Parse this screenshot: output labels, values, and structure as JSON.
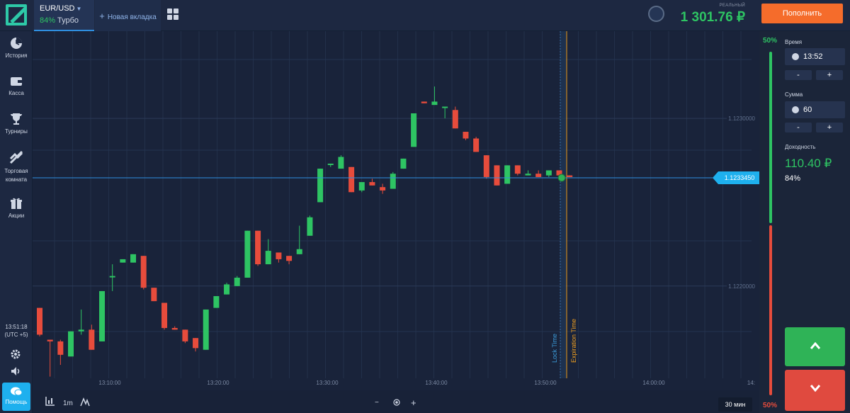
{
  "header": {
    "asset_pair": "EUR/USD",
    "asset_payout": "84%",
    "asset_mode": "Турбо",
    "new_tab_label": "Новая вкладка",
    "account_type": "РЕАЛЬНЫЙ",
    "balance": "1 301.76 ₽",
    "deposit_label": "Пополнить"
  },
  "sidebar": {
    "items": [
      {
        "label": "История",
        "icon": "history-icon"
      },
      {
        "label": "Касса",
        "icon": "wallet-icon"
      },
      {
        "label": "Турниры",
        "icon": "trophy-icon"
      },
      {
        "label": "Торговая комната",
        "icon": "trading-room-icon"
      },
      {
        "label": "Акции",
        "icon": "gift-icon"
      }
    ],
    "time": "13:51:18",
    "timezone": "(UTC +5)",
    "help_label": "Помощь"
  },
  "chart_data": {
    "type": "candlestick",
    "timeframe": "1m",
    "y_range": [
      1.12145,
      1.12352
    ],
    "y_ticks": [
      1.123,
      1.122
    ],
    "y_tick_labels": [
      "1.1230000",
      "1.1220000"
    ],
    "x_tick_labels": [
      "13:10:00",
      "13:20:00",
      "13:30:00",
      "13:40:00",
      "13:50:00",
      "14:00:00"
    ],
    "current_price": "1.1233450",
    "lock_time_label": "Lock Time",
    "expiration_time_label": "Expiration Time",
    "candles": [
      {
        "o": 1.12187,
        "h": 1.12187,
        "l": 1.1217,
        "c": 1.12171
      },
      {
        "o": 1.12168,
        "h": 1.12168,
        "l": 1.12146,
        "c": 1.12167
      },
      {
        "o": 1.12167,
        "h": 1.12168,
        "l": 1.12153,
        "c": 1.12159
      },
      {
        "o": 1.12158,
        "h": 1.12173,
        "l": 1.12158,
        "c": 1.12173
      },
      {
        "o": 1.12173,
        "h": 1.12186,
        "l": 1.12171,
        "c": 1.12174
      },
      {
        "o": 1.12174,
        "h": 1.12177,
        "l": 1.12162,
        "c": 1.12162
      },
      {
        "o": 1.12167,
        "h": 1.12197,
        "l": 1.12167,
        "c": 1.12197
      },
      {
        "o": 1.12206,
        "h": 1.12213,
        "l": 1.12197,
        "c": 1.12206
      },
      {
        "o": 1.12214,
        "h": 1.12216,
        "l": 1.12214,
        "c": 1.12216
      },
      {
        "o": 1.12214,
        "h": 1.12219,
        "l": 1.12214,
        "c": 1.12219
      },
      {
        "o": 1.12218,
        "h": 1.12218,
        "l": 1.12198,
        "c": 1.12199
      },
      {
        "o": 1.12199,
        "h": 1.12199,
        "l": 1.12191,
        "c": 1.12191
      },
      {
        "o": 1.1219,
        "h": 1.1219,
        "l": 1.12174,
        "c": 1.12175
      },
      {
        "o": 1.12175,
        "h": 1.12176,
        "l": 1.12174,
        "c": 1.12174
      },
      {
        "o": 1.12174,
        "h": 1.12174,
        "l": 1.12166,
        "c": 1.12167
      },
      {
        "o": 1.12169,
        "h": 1.12169,
        "l": 1.12161,
        "c": 1.12163
      },
      {
        "o": 1.12162,
        "h": 1.12186,
        "l": 1.12162,
        "c": 1.12186
      },
      {
        "o": 1.12187,
        "h": 1.12194,
        "l": 1.12187,
        "c": 1.12194
      },
      {
        "o": 1.12195,
        "h": 1.12202,
        "l": 1.12195,
        "c": 1.12201
      },
      {
        "o": 1.122,
        "h": 1.12206,
        "l": 1.122,
        "c": 1.12205
      },
      {
        "o": 1.12205,
        "h": 1.12233,
        "l": 1.12205,
        "c": 1.12233
      },
      {
        "o": 1.12233,
        "h": 1.12233,
        "l": 1.12212,
        "c": 1.12213
      },
      {
        "o": 1.12213,
        "h": 1.12228,
        "l": 1.12213,
        "c": 1.12221
      },
      {
        "o": 1.1222,
        "h": 1.1222,
        "l": 1.12214,
        "c": 1.12216
      },
      {
        "o": 1.12218,
        "h": 1.12218,
        "l": 1.12213,
        "c": 1.12215
      },
      {
        "o": 1.12219,
        "h": 1.12236,
        "l": 1.12219,
        "c": 1.12222
      },
      {
        "o": 1.1223,
        "h": 1.12242,
        "l": 1.1223,
        "c": 1.12241
      },
      {
        "o": 1.1225,
        "h": 1.1227,
        "l": 1.1225,
        "c": 1.1227
      },
      {
        "o": 1.12273,
        "h": 1.12273,
        "l": 1.12271,
        "c": 1.12273
      },
      {
        "o": 1.1227,
        "h": 1.12278,
        "l": 1.1227,
        "c": 1.12277
      },
      {
        "o": 1.12271,
        "h": 1.12271,
        "l": 1.12256,
        "c": 1.12256
      },
      {
        "o": 1.12257,
        "h": 1.1226,
        "l": 1.12256,
        "c": 1.12262
      },
      {
        "o": 1.12262,
        "h": 1.12264,
        "l": 1.1226,
        "c": 1.1226
      },
      {
        "o": 1.12259,
        "h": 1.12261,
        "l": 1.12255,
        "c": 1.12257
      },
      {
        "o": 1.12258,
        "h": 1.12268,
        "l": 1.12258,
        "c": 1.12267
      },
      {
        "o": 1.1227,
        "h": 1.12276,
        "l": 1.1227,
        "c": 1.12276
      },
      {
        "o": 1.12283,
        "h": 1.12303,
        "l": 1.12283,
        "c": 1.12303
      },
      {
        "o": 1.1231,
        "h": 1.1231,
        "l": 1.12309,
        "c": 1.12309
      },
      {
        "o": 1.12308,
        "h": 1.12319,
        "l": 1.12308,
        "c": 1.1231
      },
      {
        "o": 1.12307,
        "h": 1.12307,
        "l": 1.123,
        "c": 1.12307
      },
      {
        "o": 1.12305,
        "h": 1.12307,
        "l": 1.12294,
        "c": 1.12294
      },
      {
        "o": 1.12292,
        "h": 1.12292,
        "l": 1.12287,
        "c": 1.12288
      },
      {
        "o": 1.12288,
        "h": 1.12289,
        "l": 1.1228,
        "c": 1.1228
      },
      {
        "o": 1.12278,
        "h": 1.12278,
        "l": 1.12264,
        "c": 1.12265
      },
      {
        "o": 1.12272,
        "h": 1.12272,
        "l": 1.1226,
        "c": 1.1226
      },
      {
        "o": 1.12261,
        "h": 1.12272,
        "l": 1.12261,
        "c": 1.12272
      },
      {
        "o": 1.12272,
        "h": 1.12272,
        "l": 1.12266,
        "c": 1.12267
      },
      {
        "o": 1.12266,
        "h": 1.12269,
        "l": 1.12266,
        "c": 1.12267
      },
      {
        "o": 1.12267,
        "h": 1.12269,
        "l": 1.12265,
        "c": 1.12265
      },
      {
        "o": 1.12266,
        "h": 1.12269,
        "l": 1.12265,
        "c": 1.12269
      },
      {
        "o": 1.12269,
        "h": 1.12269,
        "l": 1.12266,
        "c": 1.12266
      },
      {
        "o": 1.12266,
        "h": 1.12266,
        "l": 1.12265,
        "c": 1.12265
      }
    ]
  },
  "toolbar": {
    "timeframe": "1m",
    "zoom_out": "−",
    "zoom_in": "+",
    "period": "30 мин"
  },
  "panel": {
    "sentiment_up": "50%",
    "sentiment_down": "50%",
    "time_label": "Время",
    "time_value": "13:52",
    "amount_label": "Сумма",
    "amount_value": "60",
    "minus": "-",
    "plus": "+",
    "payout_label": "Доходность",
    "payout_value": "110.40 ₽",
    "payout_percent": "84%"
  },
  "colors": {
    "up": "#2ec463",
    "down": "#e74c3c",
    "accent": "#1eb0ee",
    "deposit": "#f56c2b",
    "expiration": "#f0a020"
  }
}
